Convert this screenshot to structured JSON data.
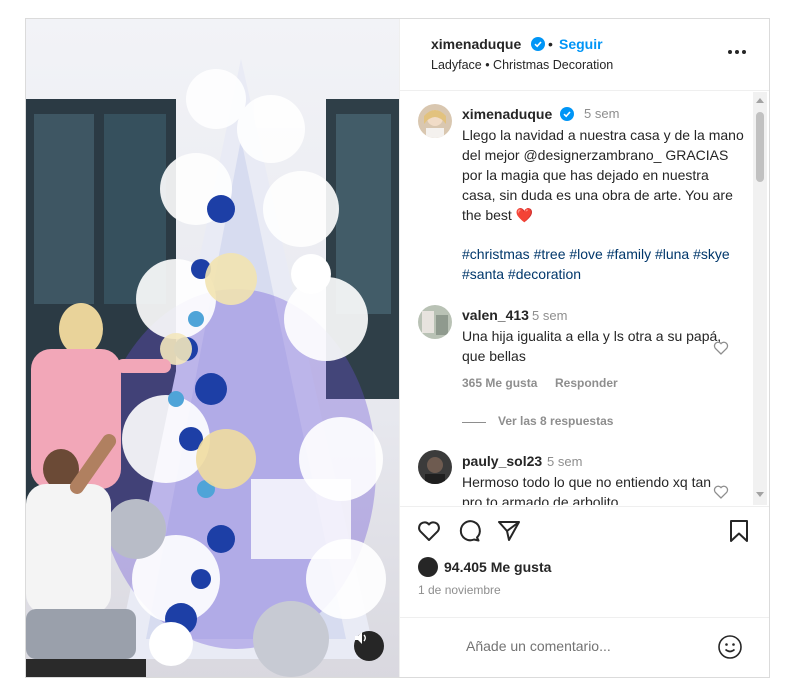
{
  "header": {
    "username": "ximenaduque",
    "separator": "•",
    "follow_label": "Seguir",
    "subtitle": "Ladyface • Christmas Decoration"
  },
  "caption": {
    "username": "ximenaduque",
    "time": "5 sem",
    "text": "Llego la navidad a nuestra casa y de la mano del mejor @designerzambrano_ GRACIAS por la magia que has dejado en nuestra casa, sin duda es una obra de arte. You are the best ❤️",
    "hashtags": "#christmas #tree #love #family #luna #skye #santa #decoration"
  },
  "comments": [
    {
      "username": "valen_413",
      "time": "5 sem",
      "text": "Una hija igualita a ella y ls otra a su papá, que bellas",
      "likes": "365 Me gusta",
      "reply_label": "Responder"
    },
    {
      "username": "pauly_sol23",
      "time": "5 sem",
      "text": "Hermoso todo lo que no entiendo xq tan pro to armado de arbolito"
    }
  ],
  "view_replies": "Ver las 8 respuestas",
  "actions": {
    "likes": "94.405 Me gusta",
    "date": "1 de noviembre"
  },
  "add_comment": {
    "placeholder": "Añade un comentario..."
  },
  "colors": {
    "link_blue": "#0095f6",
    "hashtag": "#00376b",
    "verified": "#0095f6",
    "muted": "#8e8e8e"
  },
  "icons": [
    "verified-icon",
    "more-icon",
    "heart-icon",
    "comment-icon",
    "share-icon",
    "bookmark-icon",
    "emoji-icon",
    "audio-icon"
  ]
}
